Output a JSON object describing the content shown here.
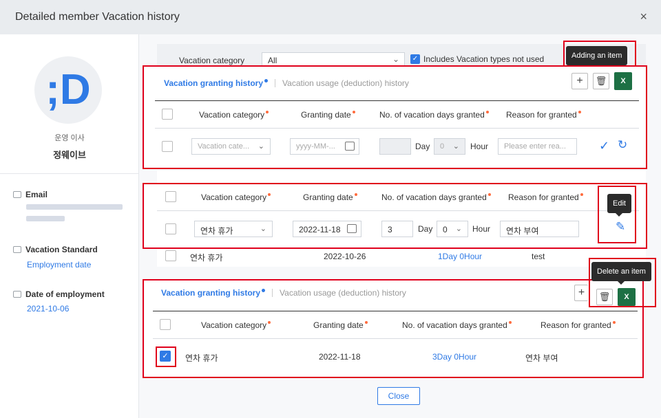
{
  "dialog": {
    "title": "Detailed member Vacation history",
    "close_icon": "×"
  },
  "profile": {
    "avatar_letter": ";D",
    "position": "운영 이사",
    "name": "정웨이브",
    "email_label": "Email",
    "standard_label": "Vacation Standard",
    "standard_value": "Employment date",
    "doe_label": "Date of employment",
    "doe_value": "2021-10-06"
  },
  "filter": {
    "category_label": "Vacation category",
    "category_value": "All",
    "include_label": "Includes Vacation types not used",
    "include_checked": true
  },
  "tabs": {
    "granting": "Vacation granting history",
    "usage": "Vacation usage (deduction) history"
  },
  "columns": {
    "category": "Vacation category",
    "date": "Granting date",
    "days": "No. of vacation days granted",
    "reason": "Reason for granted"
  },
  "tooltips": {
    "add": "Adding an item",
    "edit": "Edit",
    "delete": "Delete an item"
  },
  "add_row": {
    "category_placeholder": "Vacation cate...",
    "date_placeholder": "yyyy-MM-...",
    "day_unit": "Day",
    "hour_value": "0",
    "hour_unit": "Hour",
    "reason_placeholder": "Please enter rea..."
  },
  "edit_row": {
    "category": "연차 휴가",
    "date": "2022-11-18",
    "days": "3",
    "day_unit": "Day",
    "hour_value": "0",
    "hour_unit": "Hour",
    "reason": "연차 부여"
  },
  "bg_row": {
    "category": "연차 휴가",
    "date": "2022-10-26",
    "amount": "1Day 0Hour",
    "reason": "test"
  },
  "delete_row": {
    "category": "연차 휴가",
    "date": "2022-11-18",
    "amount": "3Day 0Hour",
    "reason": "연차 부여"
  },
  "footer": {
    "close_label": "Close"
  },
  "colors": {
    "accent": "#2f7ae5",
    "highlight": "#e0001b",
    "excel": "#1d7044"
  }
}
